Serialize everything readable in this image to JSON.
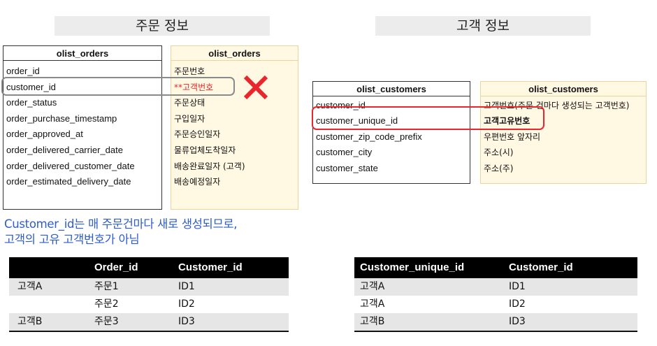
{
  "order_section": {
    "title": "주문 정보",
    "table_en": {
      "header": "olist_orders",
      "rows": [
        "order_id",
        "customer_id",
        "order_status",
        "order_purchase_timestamp",
        "order_approved_at",
        "order_delivered_carrier_date",
        "order_delivered_customer_date",
        "order_estimated_delivery_date"
      ]
    },
    "table_kr": {
      "header": "olist_orders",
      "rows": [
        "주문번호",
        "**고객번호",
        "주문상태",
        "구입일자",
        "주문승인일자",
        "물류업체도착일자",
        "배송완료일자 (고객)",
        "배송예정일자"
      ]
    },
    "highlight_color": "#8a8a8a",
    "mark_color": "#e8262b"
  },
  "customer_section": {
    "title": "고객 정보",
    "table_en": {
      "header": "olist_customers",
      "rows": [
        "customer_id",
        "customer_unique_id",
        "customer_zip_code_prefix",
        "customer_city",
        "customer_state"
      ]
    },
    "table_kr": {
      "header": "olist_customers",
      "rows": [
        "고객번호(주문 건마다 생성되는 고객번호)",
        "고객고유번호",
        "우편번호 앞자리",
        "주소(시)",
        "주소(주)"
      ]
    },
    "highlight_color": "#e8262b"
  },
  "note": {
    "line1": "Customer_id는 매 주문건마다 새로 생성되므로,",
    "line2": "고객의 고유 고객번호가 아님"
  },
  "example_left": {
    "headers": [
      "",
      "Order_id",
      "Customer_id"
    ],
    "rows": [
      [
        "고객A",
        "주문1",
        "ID1"
      ],
      [
        "",
        "주문2",
        "ID2"
      ],
      [
        "고객B",
        "주문3",
        "ID3"
      ]
    ]
  },
  "example_right": {
    "headers": [
      "Customer_unique_id",
      "Customer_id"
    ],
    "rows": [
      [
        "고객A",
        "ID1"
      ],
      [
        "고객A",
        "ID2"
      ],
      [
        "고객B",
        "ID3"
      ]
    ]
  }
}
